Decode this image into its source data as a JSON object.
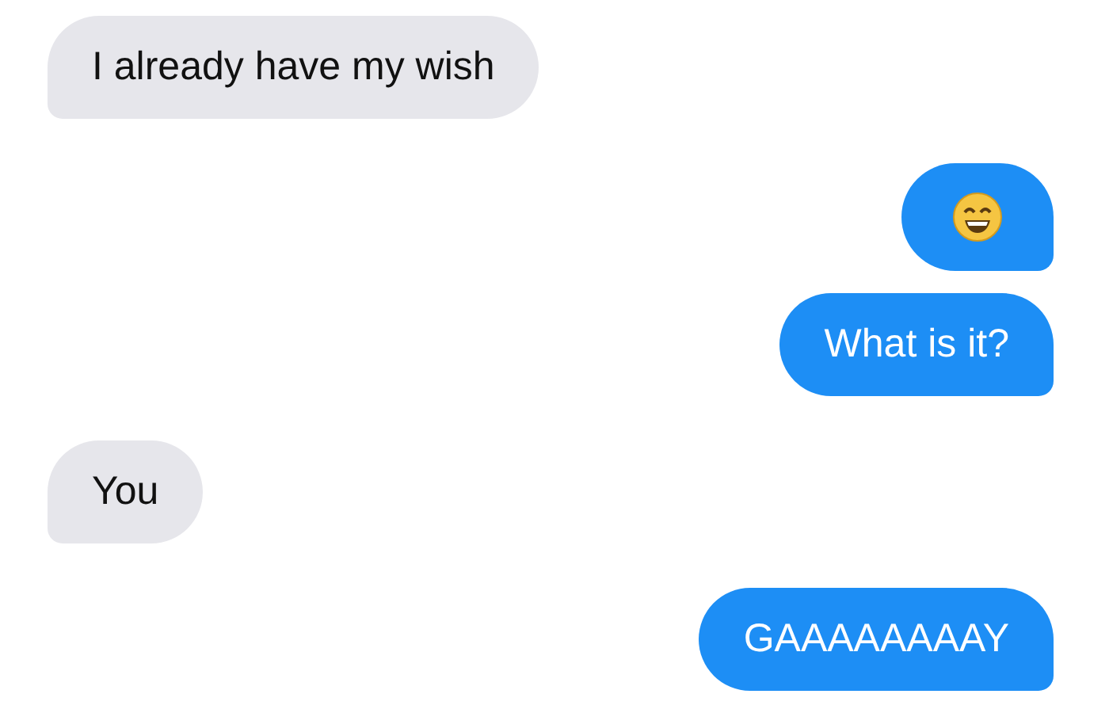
{
  "messages": [
    {
      "sent": false,
      "kind": "text",
      "text": "I already have my wish"
    },
    {
      "sent": true,
      "kind": "emoji"
    },
    {
      "sent": true,
      "kind": "text",
      "text": "What is it?"
    },
    {
      "sent": false,
      "kind": "text",
      "text": "You"
    },
    {
      "sent": true,
      "kind": "text",
      "text": "GAAAAAAAAY"
    }
  ]
}
